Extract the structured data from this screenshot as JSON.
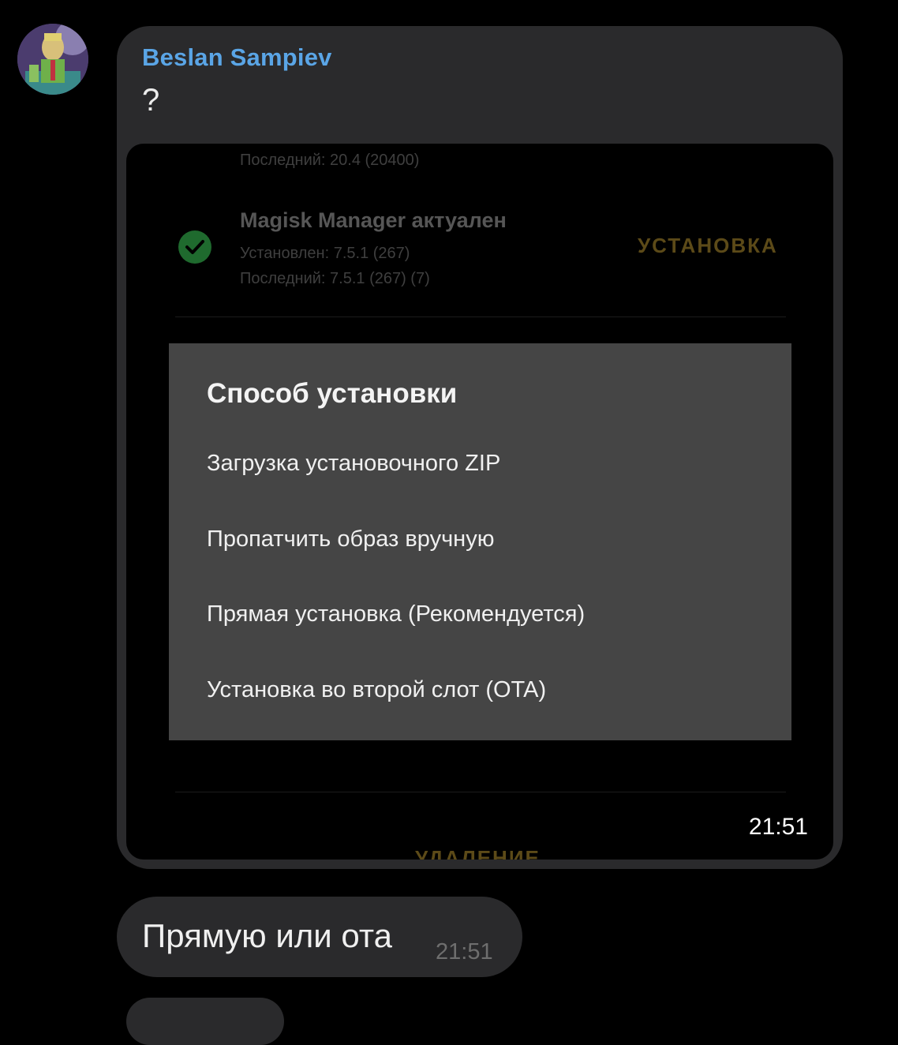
{
  "message1": {
    "sender": "Beslan Sampiev",
    "text": "?",
    "time": "21:51",
    "screenshot": {
      "top_line": "Последний: 20.4 (20400)",
      "manager_title": "Magisk Manager актуален",
      "manager_installed": "Установлен: 7.5.1 (267)",
      "manager_latest": "Последний: 7.5.1 (267) (7)",
      "install_action": "УСТАНОВКА",
      "bottom_action": "УДАЛЕНИЕ",
      "dialog": {
        "title": "Способ установки",
        "options": [
          "Загрузка установочного ZIP",
          "Пропатчить образ вручную",
          "Прямая установка (Рекомендуется)",
          "Установка во второй слот (OTA)"
        ]
      }
    }
  },
  "message2": {
    "text": "Прямую или ота",
    "time": "21:51"
  },
  "colors": {
    "background": "#000000",
    "bubble": "#2a2a2c",
    "sender": "#5aa5e6",
    "dialog": "#454545",
    "check": "#1f6a2e"
  },
  "icons": [
    "avatar",
    "check-circle-icon"
  ]
}
